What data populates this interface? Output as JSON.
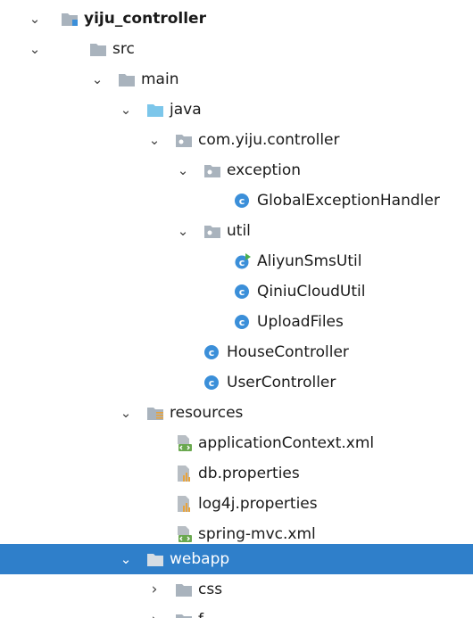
{
  "tree": {
    "root": {
      "label": "yiju_controller"
    },
    "src": {
      "label": "src"
    },
    "main": {
      "label": "main"
    },
    "java": {
      "label": "java"
    },
    "package": {
      "label": "com.yiju.controller"
    },
    "exception": {
      "label": "exception"
    },
    "global_handler": {
      "label": "GlobalExceptionHandler"
    },
    "util": {
      "label": "util"
    },
    "aliyun": {
      "label": "AliyunSmsUtil"
    },
    "qiniu": {
      "label": "QiniuCloudUtil"
    },
    "upload": {
      "label": "UploadFiles"
    },
    "house": {
      "label": "HouseController"
    },
    "user": {
      "label": "UserController"
    },
    "resources": {
      "label": "resources"
    },
    "app_context": {
      "label": "applicationContext.xml"
    },
    "db_props": {
      "label": "db.properties"
    },
    "log4j": {
      "label": "log4j.properties"
    },
    "spring_mvc": {
      "label": "spring-mvc.xml"
    },
    "webapp": {
      "label": "webapp"
    },
    "css": {
      "label": "css"
    },
    "fonts": {
      "label": "f"
    }
  },
  "colors": {
    "selection": "#2f7fca",
    "folder": "#a9b3bd",
    "source_folder": "#7cc6ea",
    "class_badge": "#3b8fd9"
  }
}
